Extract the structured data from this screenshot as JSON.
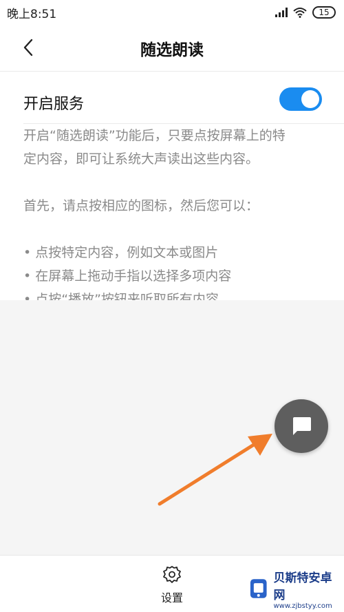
{
  "status_bar": {
    "time": "晚上8:51",
    "battery": "15"
  },
  "header": {
    "title": "随选朗读"
  },
  "service": {
    "label": "开启服务",
    "toggle_on": true
  },
  "description": {
    "line1": "开启“随选朗读”功能后，只要点按屏幕上的特",
    "line2": "定内容，即可让系统大声读出这些内容。",
    "line3": "首先，请点按相应的图标，然后您可以：",
    "bullets": [
      "点按特定内容，例如文本或图片",
      "在屏幕上拖动手指以选择多项内容",
      "点按“播放”按钮来听取所有内容"
    ]
  },
  "bottom_bar": {
    "settings_label": "设置"
  },
  "watermark": {
    "title": "贝斯特安卓网",
    "url": "www.zjbstyy.com"
  },
  "colors": {
    "accent": "#1a8cf0",
    "fab": "#5e5e5e",
    "arrow": "#f07d2c"
  }
}
